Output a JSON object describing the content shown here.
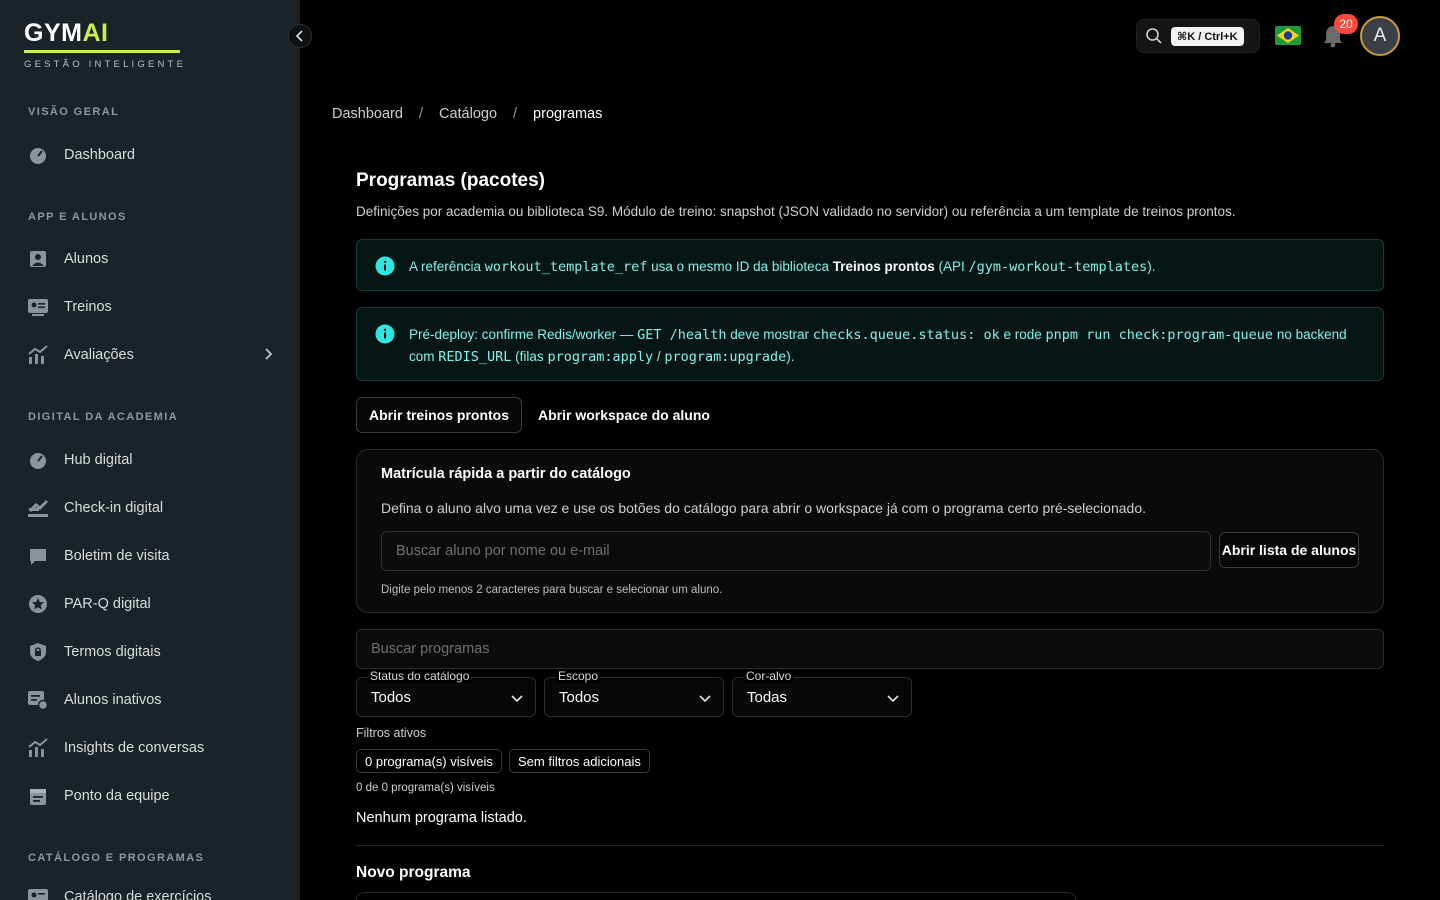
{
  "brand": {
    "name_a": "GYM",
    "name_b": "AI",
    "tagline": "GESTÃO INTELIGENTE"
  },
  "sidebar": {
    "sections": [
      {
        "label": "VISÃO GERAL"
      },
      {
        "label": "APP E ALUNOS"
      },
      {
        "label": "DIGITAL DA ACADEMIA"
      },
      {
        "label": "CATÁLOGO E PROGRAMAS"
      }
    ],
    "items": [
      {
        "label": "Dashboard",
        "icon": "gauge-icon"
      },
      {
        "label": "Alunos",
        "icon": "user-icon"
      },
      {
        "label": "Treinos",
        "icon": "id-card-icon"
      },
      {
        "label": "Avaliações",
        "icon": "chart-icon"
      },
      {
        "label": "Hub digital",
        "icon": "gauge-icon"
      },
      {
        "label": "Check-in digital",
        "icon": "checkin-icon"
      },
      {
        "label": "Boletim de visita",
        "icon": "chat-icon"
      },
      {
        "label": "PAR-Q digital",
        "icon": "star-badge-icon"
      },
      {
        "label": "Termos digitais",
        "icon": "lock-shield-icon"
      },
      {
        "label": "Alunos inativos",
        "icon": "inactive-list-icon"
      },
      {
        "label": "Insights de conversas",
        "icon": "chart-icon"
      },
      {
        "label": "Ponto da equipe",
        "icon": "calendar-icon"
      },
      {
        "label": "Catálogo de exercícios",
        "icon": "id-card-icon"
      }
    ]
  },
  "topbar": {
    "shortcut": "⌘K / Ctrl+K",
    "notifications": "20",
    "avatar_initial": "A"
  },
  "breadcrumb": {
    "items": [
      "Dashboard",
      "Catálogo",
      "programas"
    ]
  },
  "page": {
    "title": "Programas (pacotes)",
    "description": "Definições por academia ou biblioteca S9. Módulo de treino: snapshot (JSON validado no servidor) ou referência a um template de treinos prontos."
  },
  "info1": {
    "t1": "A referência ",
    "code1": "workout_template_ref",
    "t2": " usa o mesmo ID da biblioteca ",
    "bold": "Treinos prontos",
    "t3": " (API ",
    "code2": "/gym-workout-templates",
    "t4": ")."
  },
  "info2": {
    "t1": "Pré-deploy: confirme Redis/worker — ",
    "code1": "GET /health",
    "t2": " deve mostrar ",
    "code2": "checks.queue.status: ok",
    "t3": " e rode ",
    "code3": "pnpm run check:program-queue",
    "t4": " no backend com ",
    "code4": "REDIS_URL",
    "t5": " (filas ",
    "code5": "program:apply",
    "t6": " / ",
    "code6": "program:upgrade",
    "t7": ")."
  },
  "actions": {
    "open_templates": "Abrir treinos prontos",
    "open_workspace": "Abrir workspace do aluno"
  },
  "enroll": {
    "title": "Matrícula rápida a partir do catálogo",
    "description": "Defina o aluno alvo uma vez e use os botões do catálogo para abrir o workspace já com o programa certo pré-selecionado.",
    "search_placeholder": "Buscar aluno por nome ou e-mail",
    "list_button": "Abrir lista de alunos",
    "hint": "Digite pelo menos 2 caracteres para buscar e selecionar um aluno."
  },
  "filters": {
    "search_placeholder": "Buscar programas",
    "status": {
      "label": "Status do catálogo",
      "value": "Todos"
    },
    "scope": {
      "label": "Escopo",
      "value": "Todos"
    },
    "color": {
      "label": "Cor-alvo",
      "value": "Todas"
    },
    "active_label": "Filtros ativos",
    "chips": [
      "0 programa(s) visíveis",
      "Sem filtros adicionais"
    ],
    "count_text": "0 de 0 programa(s) visíveis",
    "empty_text": "Nenhum programa listado."
  },
  "new_program": {
    "title": "Novo programa"
  },
  "colors": {
    "accent": "#c6f04a",
    "info_text": "#7ef2ec",
    "badge": "#ff4a3d",
    "sidebar_bg": "#1b2328"
  }
}
